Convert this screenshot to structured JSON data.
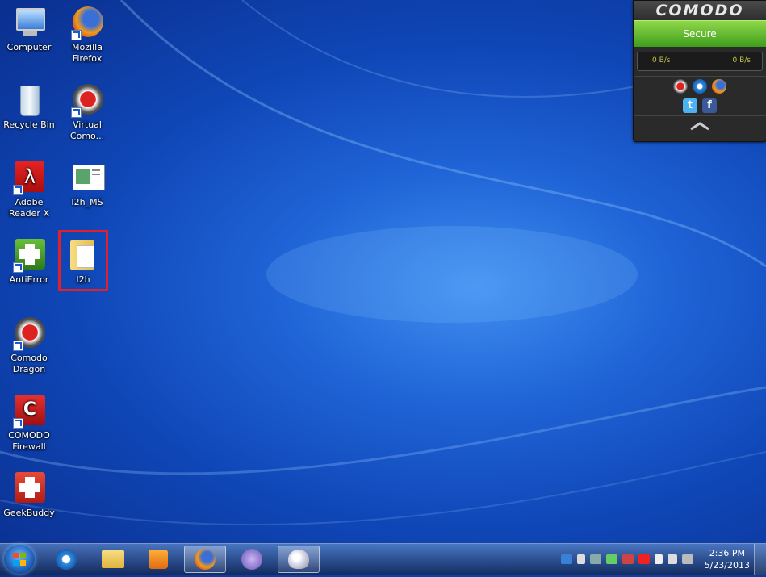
{
  "desktop": {
    "icons": [
      {
        "label": "Computer"
      },
      {
        "label": "Mozilla Firefox"
      },
      {
        "label": "Recycle Bin"
      },
      {
        "label": "Virtual Como..."
      },
      {
        "label": "Adobe Reader X"
      },
      {
        "label": "I2h_MS"
      },
      {
        "label": "AntiError"
      },
      {
        "label": "I2h"
      },
      {
        "label": "Comodo Dragon"
      },
      {
        "label": "COMODO Firewall"
      },
      {
        "label": "GeekBuddy"
      }
    ]
  },
  "comodo_widget": {
    "logo": "COMODO",
    "status": "Secure",
    "download_speed": "0 B/s",
    "upload_speed": "0 B/s"
  },
  "taskbar": {
    "clock_time": "2:36 PM",
    "clock_date": "5/23/2013"
  },
  "colors": {
    "selection_border": "#e0202b",
    "secure_green": "#3d9e1b",
    "desktop_blue": "#1f63d6"
  }
}
